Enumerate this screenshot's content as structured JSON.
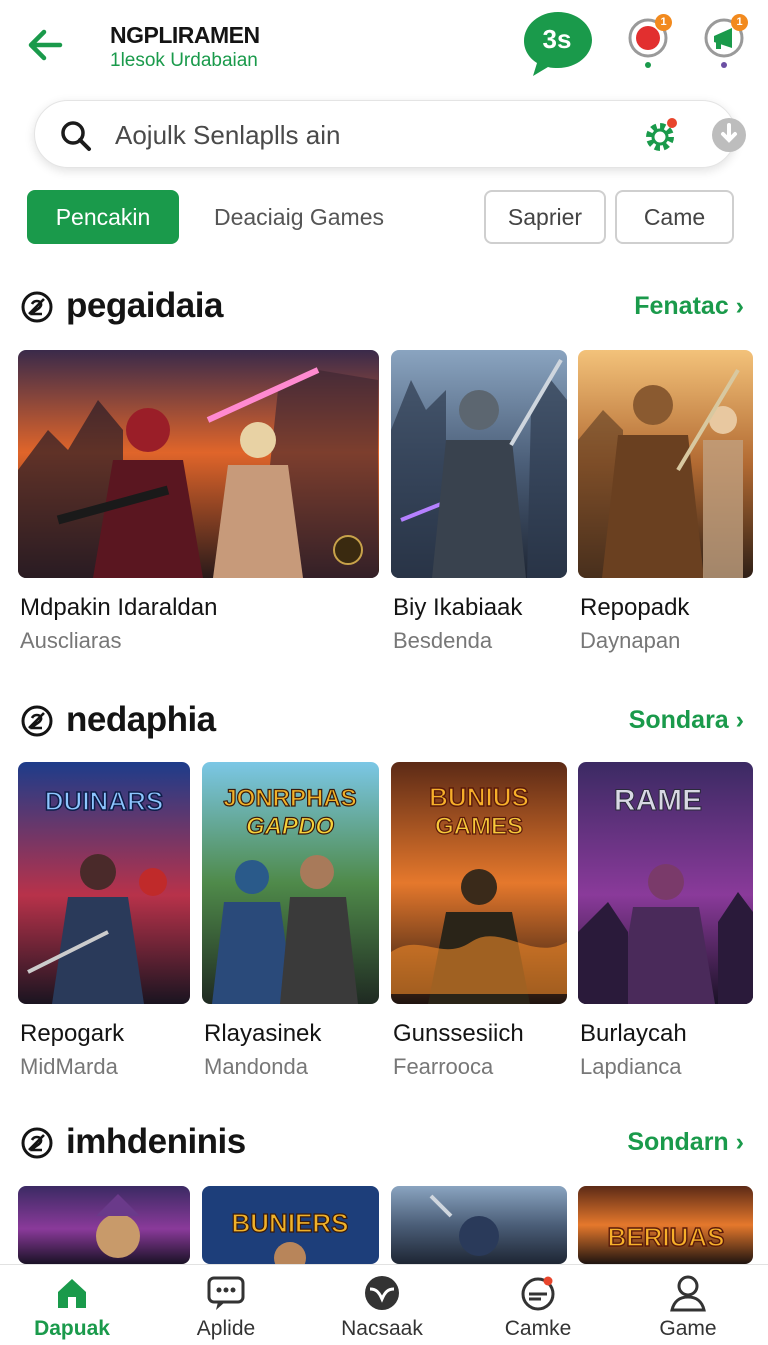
{
  "header": {
    "title": "NGPLIRAMEN",
    "subtitle": "1lesok Urdabaian",
    "timer": "3s",
    "notif_badge": "1",
    "promo_badge": "1"
  },
  "search": {
    "placeholder": "Aojulk Senlaplls ain"
  },
  "chips": {
    "active": "Pencakin",
    "second": "Deaciaig Games",
    "outline1": "Saprier",
    "outline2": "Came"
  },
  "sections": [
    {
      "title": "pegaidaia",
      "more": "Fenatac",
      "cards": [
        {
          "name": "Mdpakin Idaraldan",
          "sub": "Auscliaras"
        },
        {
          "name": "Biy Ikabiaak",
          "sub": "Besdenda"
        },
        {
          "name": "Repopadk",
          "sub": "Daynapan"
        }
      ]
    },
    {
      "title": "nedaphia",
      "more": "Sondara",
      "cards": [
        {
          "name": "Repogark",
          "sub": "MidMarda",
          "logo": "DUINARS"
        },
        {
          "name": "Rlayasinek",
          "sub": "Mandonda",
          "logo": "JONRPHAS",
          "logo2": "GAPDO"
        },
        {
          "name": "Gunssesiich",
          "sub": "Fearrooca",
          "logo": "BUNIUS",
          "logo2": "GAMES"
        },
        {
          "name": "Burlaycah",
          "sub": "Lapdianca",
          "logo": "RAME"
        }
      ]
    },
    {
      "title": "imhdeninis",
      "more": "Sondarn",
      "cards": [
        {
          "logo": ""
        },
        {
          "logo": "BUNIERS"
        },
        {
          "logo": ""
        },
        {
          "logo": "BERIUAS"
        }
      ]
    }
  ],
  "nav": [
    {
      "label": "Dapuak",
      "icon": "home-icon"
    },
    {
      "label": "Aplide",
      "icon": "chat-icon"
    },
    {
      "label": "Nacsaak",
      "icon": "shield-icon"
    },
    {
      "label": "Camke",
      "icon": "game-icon"
    },
    {
      "label": "Game",
      "icon": "profile-icon"
    }
  ],
  "colors": {
    "accent": "#1a9a4b",
    "badge": "#f28a1e"
  }
}
